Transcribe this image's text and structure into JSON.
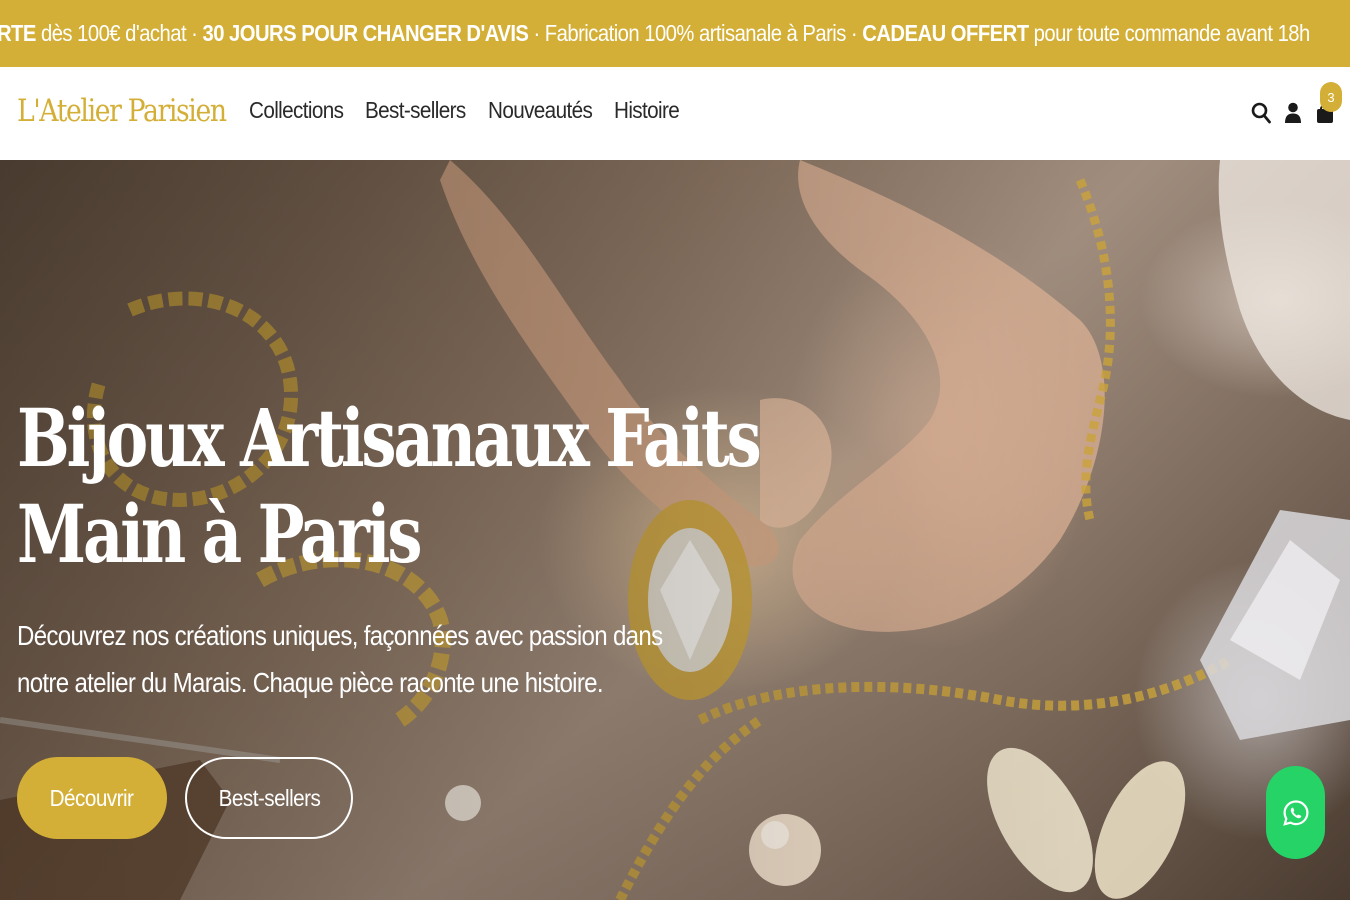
{
  "announcement": {
    "segments": [
      {
        "text": "ERTE",
        "bold": true
      },
      {
        "text": " dès 100€ d'achat",
        "bold": false
      },
      {
        "text": " · ",
        "bold": false
      },
      {
        "text": "30 JOURS POUR CHANGER D'AVIS",
        "bold": true
      },
      {
        "text": " · Fabrication 100% artisanale à Paris · ",
        "bold": false
      },
      {
        "text": "CADEAU OFFERT",
        "bold": true
      },
      {
        "text": " pour toute commande avant 18h",
        "bold": false
      }
    ]
  },
  "header": {
    "logo": "L'Atelier Parisien",
    "nav": [
      "Collections",
      "Best-sellers",
      "Nouveautés",
      "Histoire"
    ],
    "icons": [
      "search-icon",
      "user-icon",
      "cart-icon"
    ],
    "cart_count": "3"
  },
  "hero": {
    "title_line1": "Bijoux Artisanaux Faits",
    "title_line2": "Main à Paris",
    "subtitle_line1": "Découvrez nos créations uniques, façonnées avec passion dans",
    "subtitle_line2": "notre atelier du Marais. Chaque pièce raconte une histoire.",
    "primary_button": "Découvrir",
    "secondary_button": "Best-sellers"
  },
  "floating": {
    "whatsapp_icon": "whatsapp-icon"
  },
  "colors": {
    "gold": "#d4af37",
    "white": "#ffffff",
    "text_dark": "#2a2a2a",
    "whatsapp": "#25d366"
  }
}
